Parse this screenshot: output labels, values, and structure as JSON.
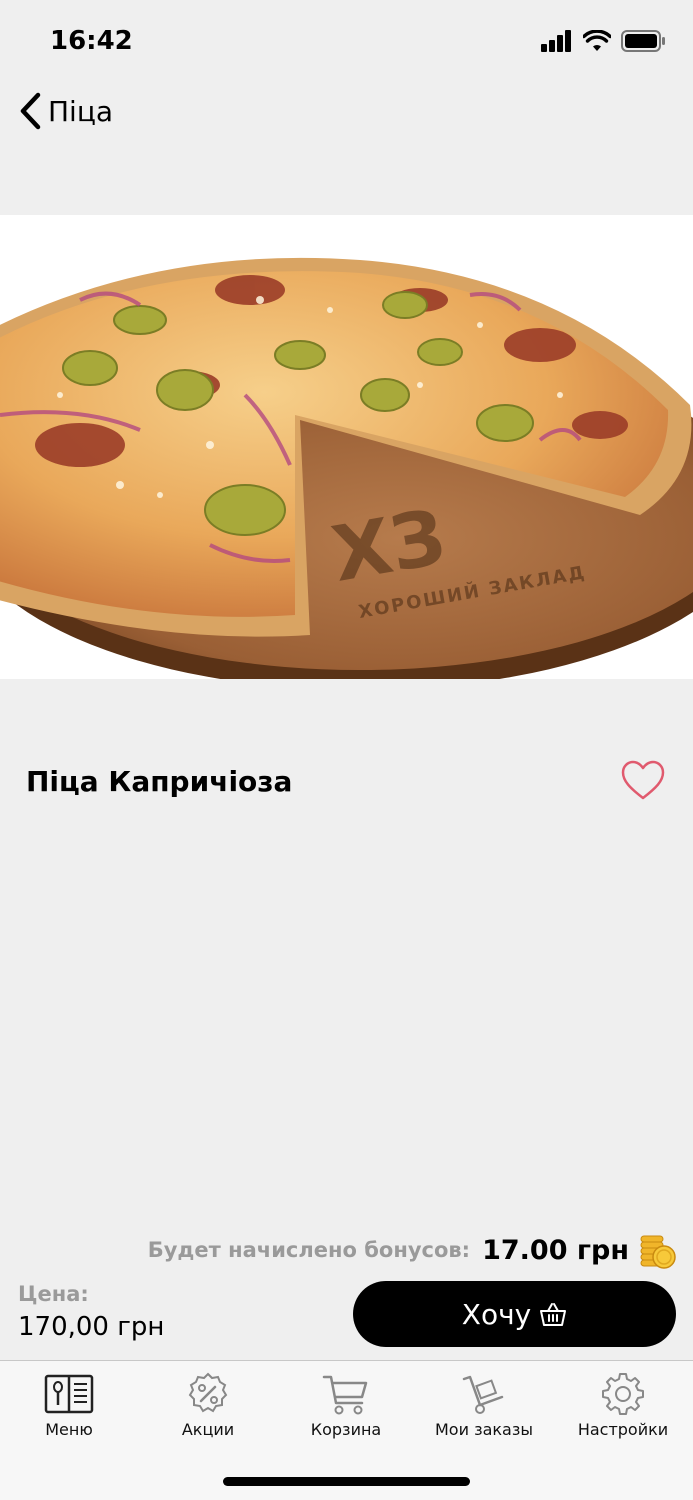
{
  "status_bar": {
    "time": "16:42",
    "icons": [
      "signal-icon",
      "wifi-icon",
      "battery-icon"
    ]
  },
  "nav": {
    "back_label": "Піца",
    "back_icon": "chevron-left-icon"
  },
  "product": {
    "image_description_icon": "pizza-photo",
    "board_logo_text": "ХЗ",
    "board_logo_subtitle": "ХОРОШИЙ ЗАКЛАД",
    "title": "Піца Капричіоза",
    "favorite_icon": "heart-outline-icon"
  },
  "bonus": {
    "label": "Будет начислено бонусов:",
    "value": "17.00 грн",
    "icon": "coins-icon"
  },
  "price": {
    "label": "Цена:",
    "value": "170,00 грн"
  },
  "cta": {
    "label": "Хочу",
    "icon": "basket-icon"
  },
  "tabs": [
    {
      "label": "Меню",
      "icon": "menu-book-icon"
    },
    {
      "label": "Акции",
      "icon": "percent-badge-icon"
    },
    {
      "label": "Корзина",
      "icon": "cart-icon"
    },
    {
      "label": "Мои заказы",
      "icon": "hand-truck-icon"
    },
    {
      "label": "Настройки",
      "icon": "gear-icon"
    }
  ],
  "colors": {
    "background": "#efefef",
    "accent_heart": "#e05a6e",
    "button": "#000000",
    "muted_text": "#9a9a9a"
  }
}
